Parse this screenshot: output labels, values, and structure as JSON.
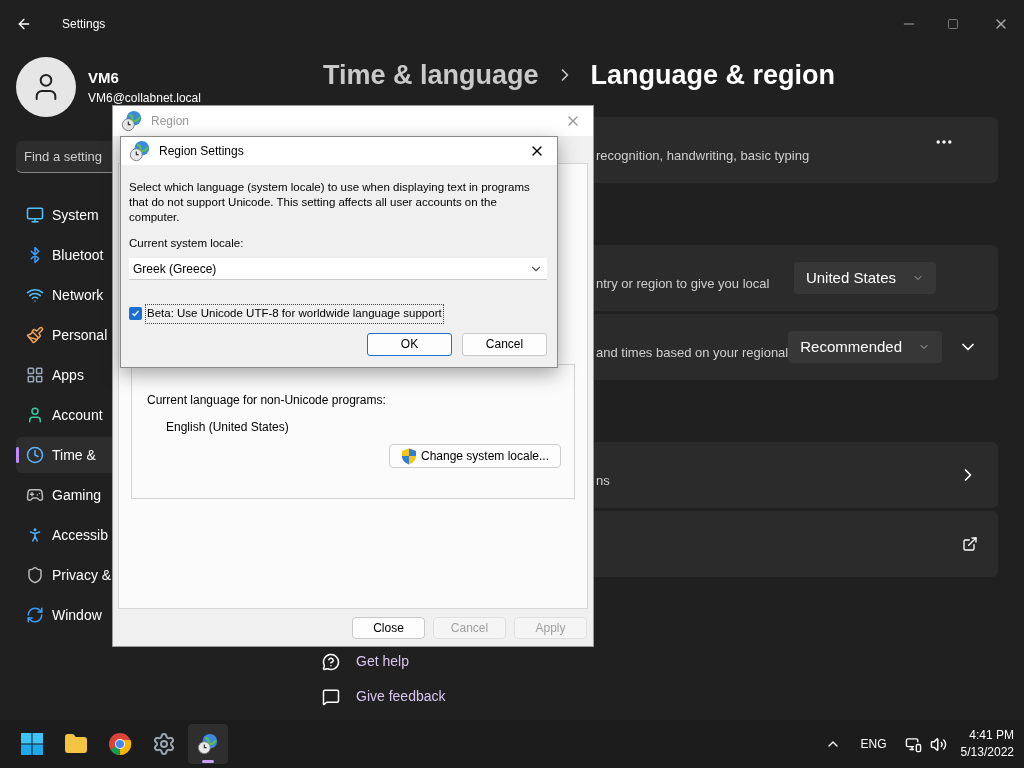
{
  "window": {
    "title": "Settings"
  },
  "user": {
    "name": "VM6",
    "email": "VM6@collabnet.local"
  },
  "search": {
    "placeholder": "Find a setting"
  },
  "sidebar": {
    "items": [
      {
        "label": "System",
        "selected": false
      },
      {
        "label": "Bluetoot",
        "selected": false
      },
      {
        "label": "Network",
        "selected": false
      },
      {
        "label": "Personal",
        "selected": false
      },
      {
        "label": "Apps",
        "selected": false
      },
      {
        "label": "Account",
        "selected": false
      },
      {
        "label": "Time &",
        "selected": true
      },
      {
        "label": "Gaming",
        "selected": false
      },
      {
        "label": "Accessib",
        "selected": false
      },
      {
        "label": "Privacy &",
        "selected": false
      },
      {
        "label": "Window",
        "selected": false
      }
    ]
  },
  "breadcrumb": {
    "parent": "Time & language",
    "current": "Language & region"
  },
  "card_groups": [
    [
      {
        "kind": "more",
        "text": "recognition, handwriting, basic typing"
      }
    ],
    [
      {
        "kind": "dropdown",
        "text": "ntry or region to give you local",
        "value": "United States"
      },
      {
        "kind": "dropdown-expand",
        "text": "and times based on your regional",
        "value": "Recommended"
      }
    ],
    [
      {
        "kind": "link",
        "text": "ns"
      },
      {
        "kind": "external"
      }
    ]
  ],
  "footer_links": [
    {
      "label": "Get help"
    },
    {
      "label": "Give feedback"
    }
  ],
  "region_dialog": {
    "title": "Region",
    "current_language_label": "Current language for non-Unicode programs:",
    "current_language": "English (United States)",
    "change_button": "Change system locale...",
    "buttons": [
      {
        "label": "Close",
        "disabled": false
      },
      {
        "label": "Cancel",
        "disabled": true
      },
      {
        "label": "Apply",
        "disabled": true
      }
    ]
  },
  "region_settings_dialog": {
    "title": "Region Settings",
    "description": "Select which language (system locale) to use when displaying text in programs that do not support Unicode. This setting affects all user accounts on the computer.",
    "locale_label": "Current system locale:",
    "locale_value": "Greek (Greece)",
    "beta": {
      "label": "Beta: Use Unicode UTF-8 for worldwide language support",
      "checked": true
    },
    "buttons": [
      {
        "label": "OK",
        "default": true
      },
      {
        "label": "Cancel",
        "default": false
      }
    ]
  },
  "taskbar": {
    "apps": [
      {
        "active": false
      },
      {
        "active": false
      },
      {
        "active": false
      },
      {
        "active": false
      },
      {
        "active": true
      }
    ],
    "language": "ENG",
    "time": "4:41 PM",
    "date": "5/13/2022"
  }
}
